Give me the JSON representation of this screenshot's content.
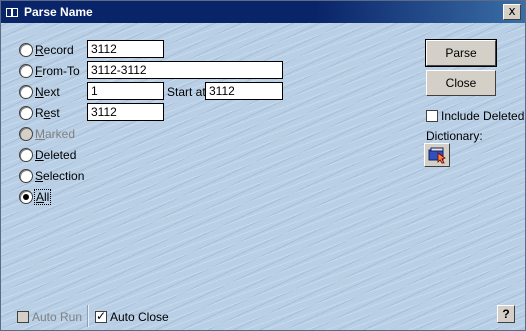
{
  "window": {
    "title": "Parse Name",
    "close_glyph": "x"
  },
  "scope": {
    "options": [
      {
        "label": "Record",
        "accel": "R"
      },
      {
        "label": "From-To",
        "accel": "F"
      },
      {
        "label": "Next",
        "accel": "N"
      },
      {
        "label": "Rest",
        "accel": "e"
      },
      {
        "label": "Marked",
        "accel": "M",
        "disabled": true
      },
      {
        "label": "Deleted",
        "accel": "D"
      },
      {
        "label": "Selection",
        "accel": "S"
      },
      {
        "label": "All",
        "accel": "A",
        "selected": true
      }
    ],
    "record_value": "3112",
    "fromto_value": "3112-3112",
    "next_value": "1",
    "start_at_label": "Start at:",
    "start_at_value": "3112",
    "rest_value": "3112"
  },
  "buttons": {
    "parse": "Parse",
    "close": "Close",
    "help": "?"
  },
  "include_deleted": {
    "label": "Include Deleted",
    "checked": false
  },
  "dictionary": {
    "label": "Dictionary:",
    "icon": "dictionary-icon"
  },
  "footer": {
    "auto_run": {
      "label": "Auto Run",
      "checked": false,
      "disabled": true
    },
    "auto_close": {
      "label": "Auto Close",
      "checked": true
    }
  }
}
